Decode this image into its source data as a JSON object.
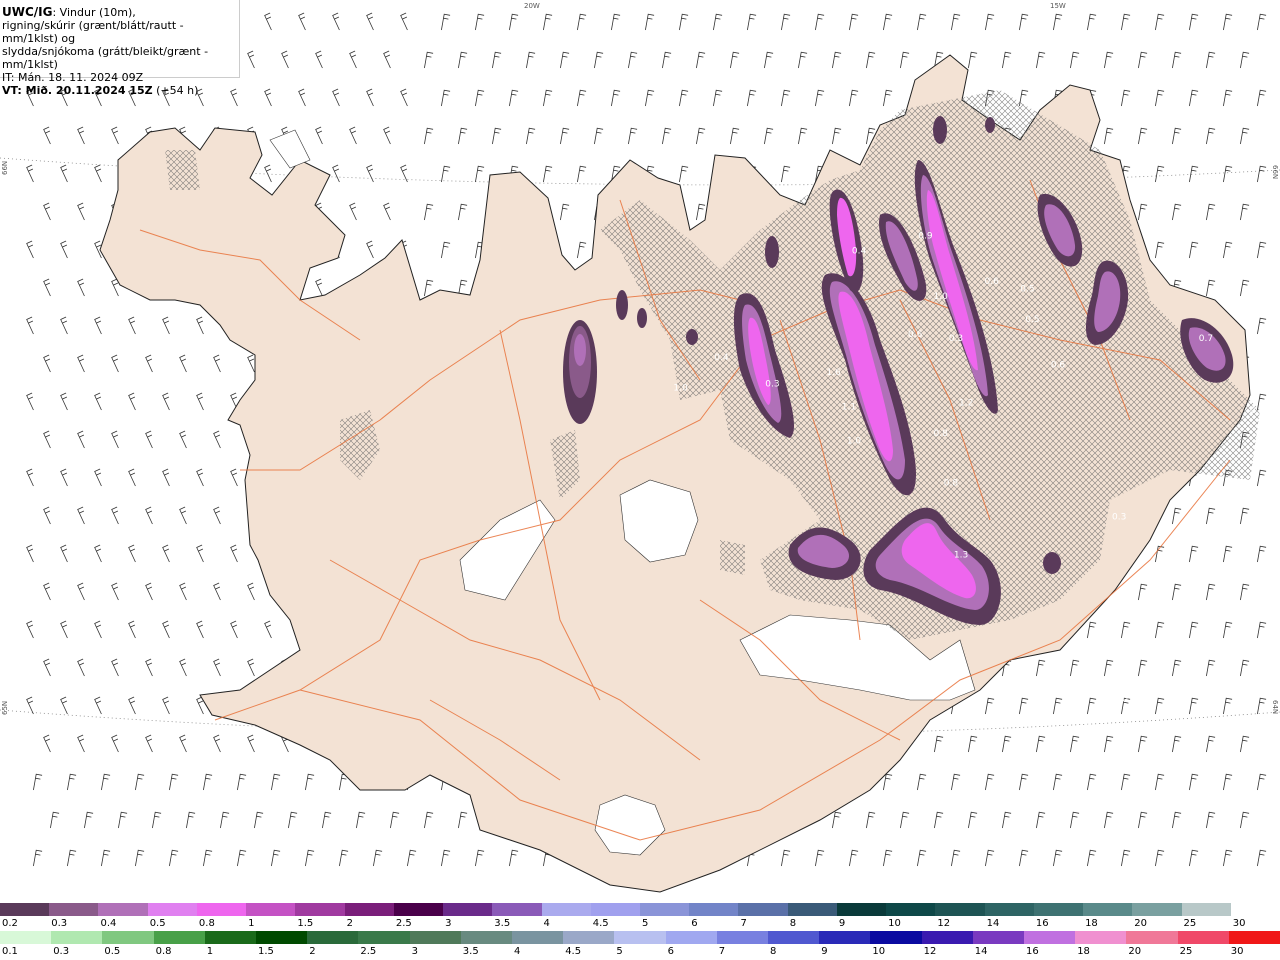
{
  "header": {
    "title_bold": "UWC/IG",
    "title_rest": ": Vindur (10m),",
    "line2": "rigning/skúrir (grænt/blátt/rautt - mm/1klst) og",
    "line3": "slydda/snjókoma (grátt/bleikt/grænt - mm/1klst)",
    "it": "IT: Mán. 18. 11. 2024 09Z",
    "vt_bold": "VT: Mið. 20.11.2024 15Z",
    "vt_rest": " (+54 h)"
  },
  "graticule": {
    "lon_top": [
      "20W",
      "15W"
    ],
    "lat_left": [
      "66N",
      "65N"
    ],
    "lat_right": [
      "66N",
      "64N"
    ]
  },
  "precip_labels": [
    {
      "text": "1.0",
      "lon": -18.7,
      "lat": 65.72
    },
    {
      "text": "0.4",
      "lon": -18.3,
      "lat": 65.8
    },
    {
      "text": "0.3",
      "lon": -17.8,
      "lat": 65.73
    },
    {
      "text": "1.6",
      "lon": -17.2,
      "lat": 65.76
    },
    {
      "text": "1.1",
      "lon": -17.05,
      "lat": 65.67
    },
    {
      "text": "1.0",
      "lon": -17.0,
      "lat": 65.58
    },
    {
      "text": "0.4",
      "lon": -16.95,
      "lat": 66.08
    },
    {
      "text": "0.9",
      "lon": -16.3,
      "lat": 66.12
    },
    {
      "text": "1.0",
      "lon": -16.15,
      "lat": 65.96
    },
    {
      "text": "0.6",
      "lon": -16.4,
      "lat": 65.86
    },
    {
      "text": "0.3",
      "lon": -16.0,
      "lat": 65.85
    },
    {
      "text": "1.2",
      "lon": -15.9,
      "lat": 65.68
    },
    {
      "text": "0.8",
      "lon": -16.15,
      "lat": 65.6
    },
    {
      "text": "0.8",
      "lon": -16.05,
      "lat": 65.47
    },
    {
      "text": "1.3",
      "lon": -15.95,
      "lat": 65.28
    },
    {
      "text": "0.6",
      "lon": -15.65,
      "lat": 66.0
    },
    {
      "text": "0.5",
      "lon": -15.3,
      "lat": 65.98
    },
    {
      "text": "0.5",
      "lon": -15.25,
      "lat": 65.9
    },
    {
      "text": "0.6",
      "lon": -15.0,
      "lat": 65.78
    },
    {
      "text": "0.3",
      "lon": -14.4,
      "lat": 65.38
    },
    {
      "text": "0.6",
      "lon": -13.85,
      "lat": 66.1
    },
    {
      "text": "0.7",
      "lon": -13.55,
      "lat": 65.85
    },
    {
      "text": "0.7",
      "lon": -13.05,
      "lat": 65.66
    },
    {
      "text": "0.3",
      "lon": -12.95,
      "lat": 65.56
    },
    {
      "text": "0.5",
      "lon": -16.5,
      "lat": 64.92
    },
    {
      "text": "0.7",
      "lon": -15.2,
      "lat": 64.96
    },
    {
      "text": "0.7",
      "lon": -15.05,
      "lat": 64.99
    },
    {
      "text": "0.8",
      "lon": -14.75,
      "lat": 64.83
    },
    {
      "text": "0.2",
      "lon": -14.3,
      "lat": 64.9
    },
    {
      "text": "0.3",
      "lon": -14.1,
      "lat": 64.92
    }
  ],
  "legend_snow": [
    {
      "label": "0.2",
      "color": "#5a3a5a"
    },
    {
      "label": "0.3",
      "color": "#8a5a8a"
    },
    {
      "label": "0.4",
      "color": "#b070b8"
    },
    {
      "label": "0.5",
      "color": "#e080f0"
    },
    {
      "label": "0.8",
      "color": "#ee66ee"
    },
    {
      "label": "1",
      "color": "#c452c4"
    },
    {
      "label": "1.5",
      "color": "#a03aa0"
    },
    {
      "label": "2",
      "color": "#7a1e7a"
    },
    {
      "label": "2.5",
      "color": "#4a004a"
    },
    {
      "label": "3",
      "color": "#6a2a8a"
    },
    {
      "label": "3.5",
      "color": "#8a5ab8"
    },
    {
      "label": "4",
      "color": "#aaaaee"
    },
    {
      "label": "4.5",
      "color": "#a0a0ee"
    },
    {
      "label": "5",
      "color": "#8a94d8"
    },
    {
      "label": "6",
      "color": "#7284c8"
    },
    {
      "label": "7",
      "color": "#5a70a8"
    },
    {
      "label": "8",
      "color": "#3a5a78"
    },
    {
      "label": "9",
      "color": "#0a3a3a"
    },
    {
      "label": "10",
      "color": "#0e4848"
    },
    {
      "label": "12",
      "color": "#1e5454"
    },
    {
      "label": "14",
      "color": "#2e6464"
    },
    {
      "label": "16",
      "color": "#3e7272"
    },
    {
      "label": "18",
      "color": "#5a8a8a"
    },
    {
      "label": "20",
      "color": "#7aa0a0"
    },
    {
      "label": "25",
      "color": "#b8c8c8"
    },
    {
      "label": "30",
      "color": "#ffffff"
    }
  ],
  "legend_rain": [
    {
      "label": "0.1",
      "color": "#d8f8d8"
    },
    {
      "label": "0.3",
      "color": "#b0e8b0"
    },
    {
      "label": "0.5",
      "color": "#80c880"
    },
    {
      "label": "0.8",
      "color": "#48a048"
    },
    {
      "label": "1",
      "color": "#1a6a1a"
    },
    {
      "label": "1.5",
      "color": "#004a00"
    },
    {
      "label": "2",
      "color": "#2a6a3a"
    },
    {
      "label": "2.5",
      "color": "#3a7a4a"
    },
    {
      "label": "3",
      "color": "#507a5a"
    },
    {
      "label": "3.5",
      "color": "#688a80"
    },
    {
      "label": "4",
      "color": "#7a94a0"
    },
    {
      "label": "4.5",
      "color": "#9aa8c8"
    },
    {
      "label": "5",
      "color": "#b8c0f0"
    },
    {
      "label": "6",
      "color": "#a0a8f0"
    },
    {
      "label": "7",
      "color": "#7880e0"
    },
    {
      "label": "8",
      "color": "#5058d0"
    },
    {
      "label": "9",
      "color": "#2a2ab8"
    },
    {
      "label": "10",
      "color": "#0a0aa0"
    },
    {
      "label": "12",
      "color": "#3a1ab0"
    },
    {
      "label": "14",
      "color": "#7a3ac0"
    },
    {
      "label": "16",
      "color": "#c070e0"
    },
    {
      "label": "18",
      "color": "#f090d0"
    },
    {
      "label": "20",
      "color": "#f07898"
    },
    {
      "label": "25",
      "color": "#f04868"
    },
    {
      "label": "30",
      "color": "#f01818"
    }
  ]
}
